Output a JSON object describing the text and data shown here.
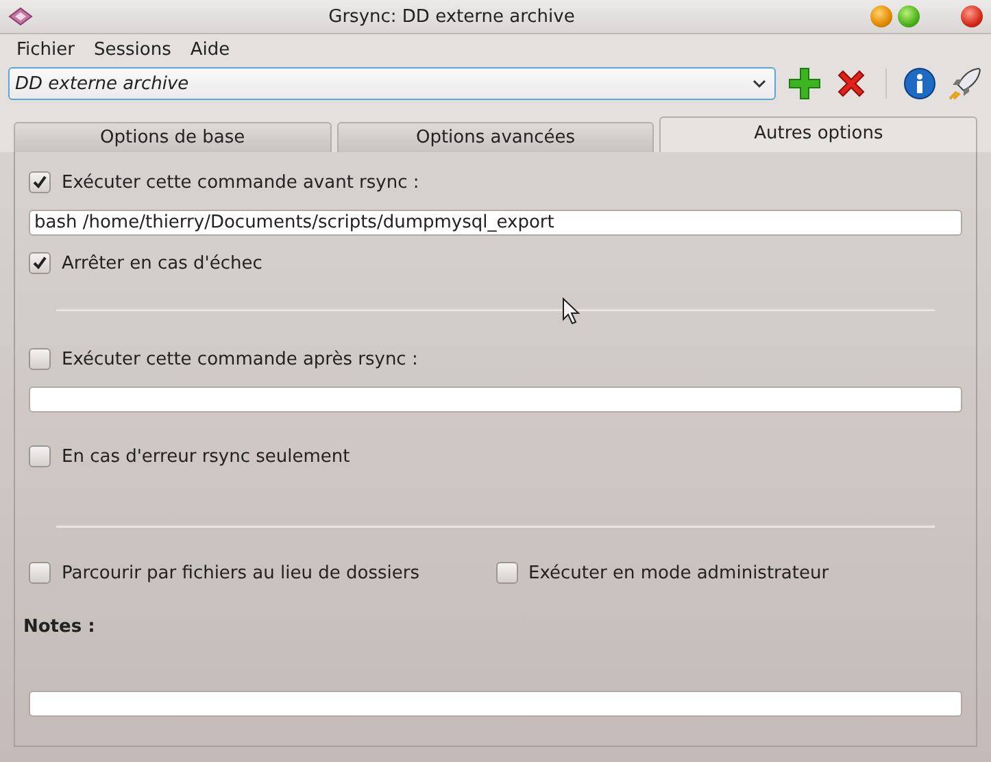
{
  "window": {
    "title": "Grsync: DD externe archive"
  },
  "menu": [
    {
      "label": "Fichier"
    },
    {
      "label": "Sessions"
    },
    {
      "label": "Aide"
    }
  ],
  "session": {
    "value": "DD externe archive"
  },
  "tabs": [
    {
      "label": "Options de base",
      "selected": false
    },
    {
      "label": "Options avancées",
      "selected": false
    },
    {
      "label": "Autres options",
      "selected": true
    }
  ],
  "panel": [
    {
      "kind": "checkbox",
      "label": "Exécuter cette commande avant rsync :",
      "checked": true
    },
    {
      "kind": "field",
      "value": "bash /home/thierry/Documents/scripts/dumpmysql_export"
    },
    {
      "kind": "checkbox",
      "label": "Arrêter en cas d'échec",
      "checked": true
    },
    {
      "kind": "separator"
    },
    {
      "kind": "checkbox",
      "label": "Exécuter cette commande après rsync :",
      "checked": false
    },
    {
      "kind": "field"
    },
    {
      "kind": "checkbox",
      "label": "En cas d'erreur rsync seulement",
      "checked": false
    },
    {
      "kind": "separator"
    },
    {
      "kind": "pair",
      "items": [
        {
          "label": "Parcourir par fichiers au lieu de dossiers",
          "checked": false
        },
        {
          "label": "Exécuter en mode administrateur",
          "checked": false
        }
      ]
    },
    {
      "kind": "heading",
      "label": "Notes :"
    },
    {
      "kind": "field"
    }
  ]
}
